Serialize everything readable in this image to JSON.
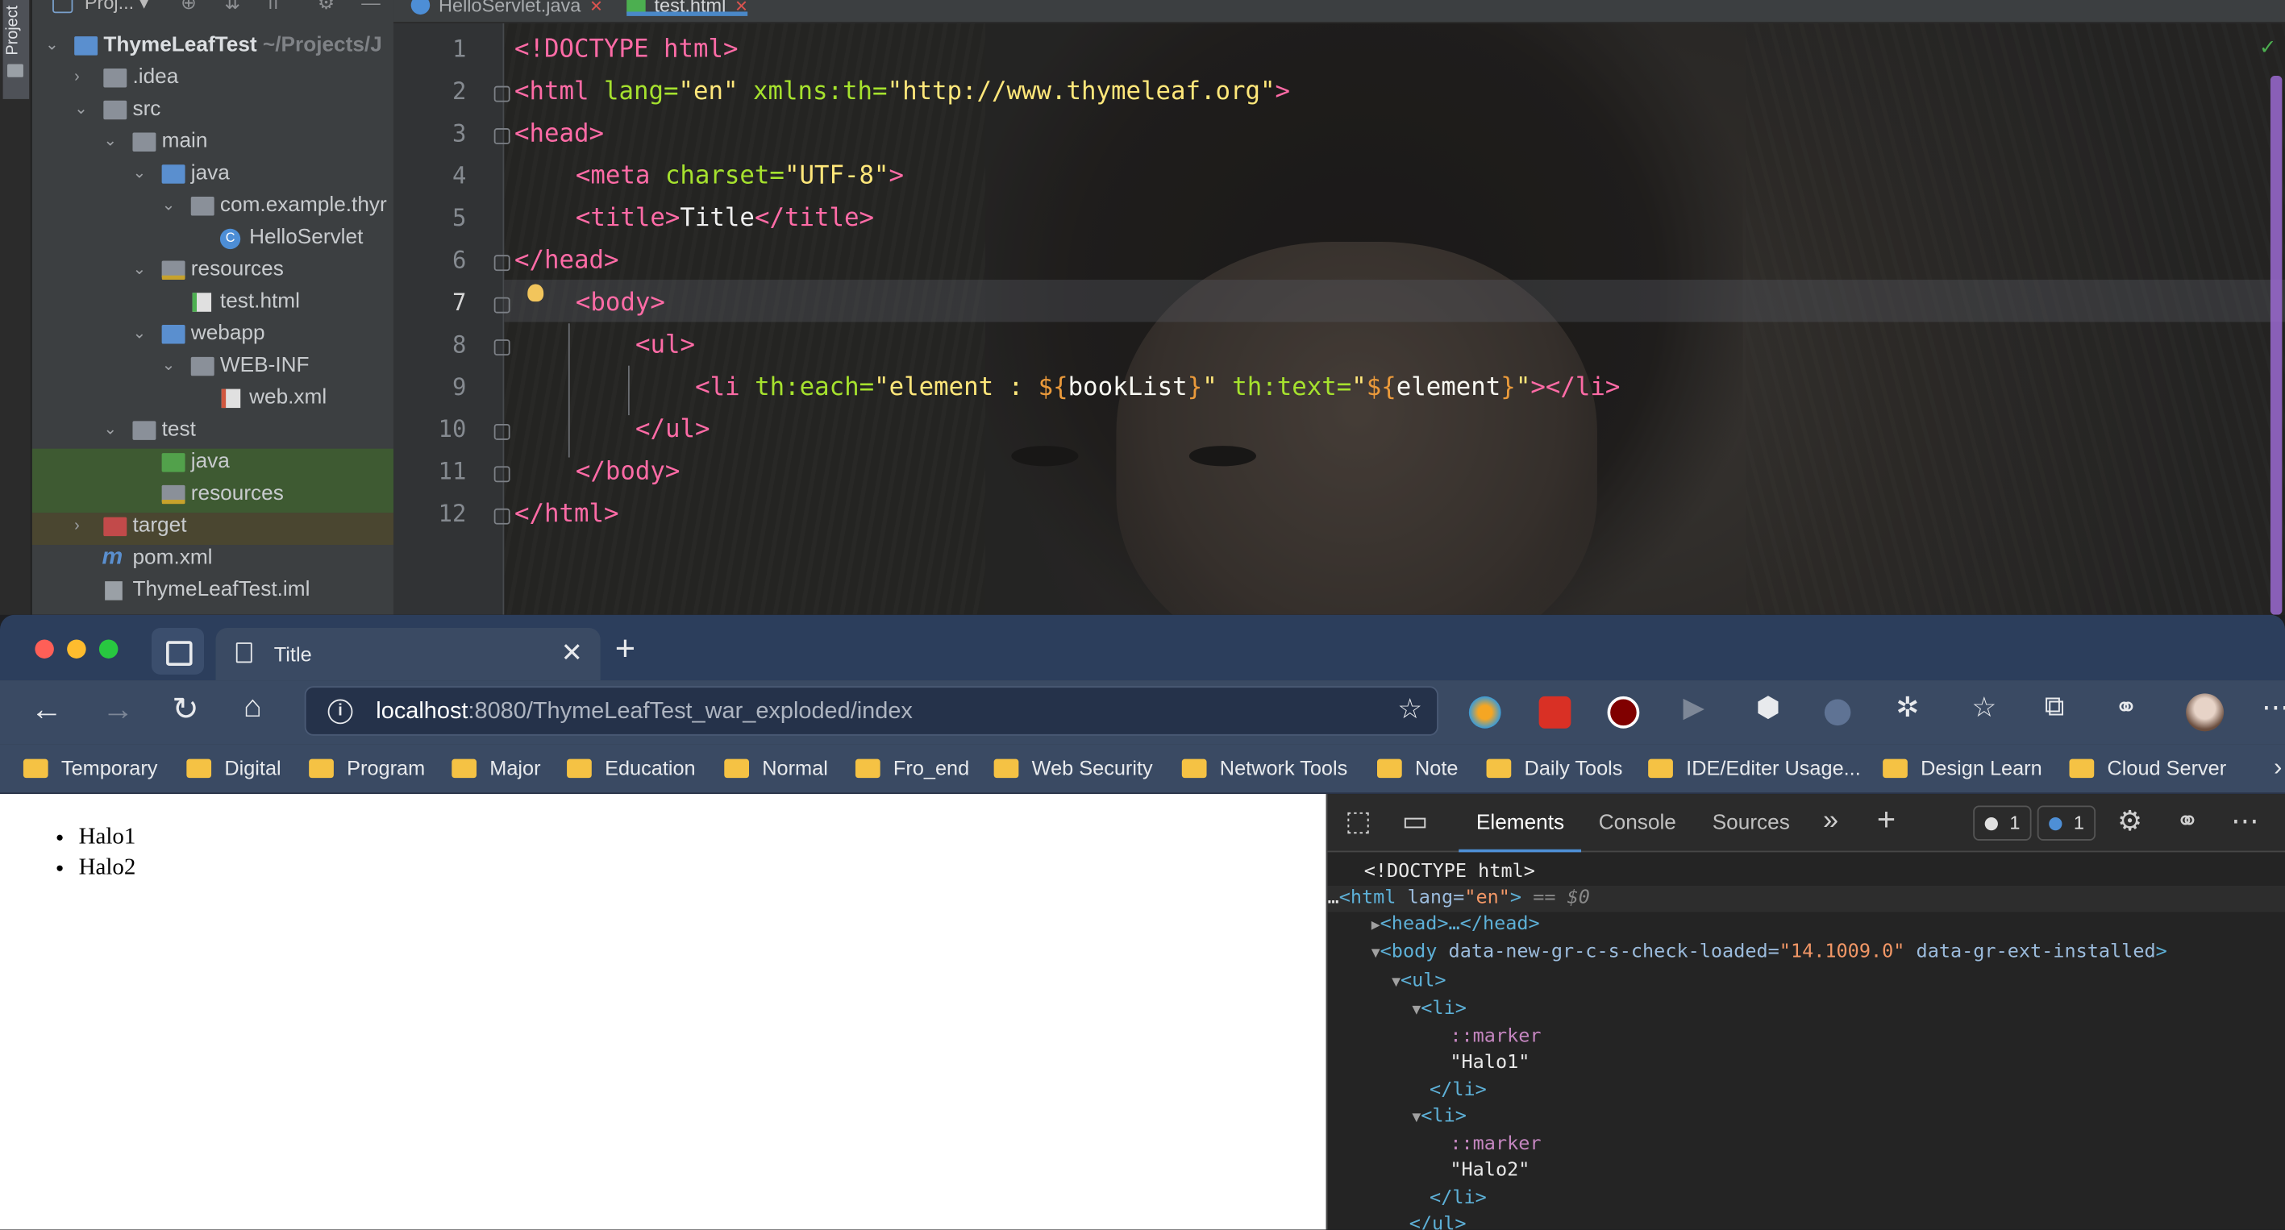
{
  "ide": {
    "project_label": "Proj...",
    "sidebar_tab_label": "Project",
    "tabs": [
      {
        "label": "HelloServlet.java"
      },
      {
        "label": "test.html"
      }
    ],
    "tree": [
      {
        "label": "ThymeLeafTest",
        "sub": "~/Projects/J"
      },
      {
        "label": ".idea"
      },
      {
        "label": "src"
      },
      {
        "label": "main"
      },
      {
        "label": "java"
      },
      {
        "label": "com.example.thyr"
      },
      {
        "label": "HelloServlet"
      },
      {
        "label": "resources"
      },
      {
        "label": "test.html"
      },
      {
        "label": "webapp"
      },
      {
        "label": "WEB-INF"
      },
      {
        "label": "web.xml"
      },
      {
        "label": "test"
      },
      {
        "label": "java"
      },
      {
        "label": "resources"
      },
      {
        "label": "target"
      },
      {
        "label": "pom.xml"
      },
      {
        "label": "ThymeLeafTest.iml"
      }
    ],
    "line_numbers": [
      "1",
      "2",
      "3",
      "4",
      "5",
      "6",
      "7",
      "8",
      "9",
      "10",
      "11",
      "12"
    ],
    "code": {
      "l1": [
        "<!DOCTYPE html>"
      ],
      "l2": [
        "<html",
        " lang=",
        "\"en\"",
        " xmlns:th=",
        "\"http://www.thymeleaf.org\"",
        ">"
      ],
      "l3": [
        "<head>"
      ],
      "l4": [
        "<meta",
        " charset=",
        "\"UTF-8\"",
        ">"
      ],
      "l5": [
        "<title>",
        "Title",
        "</title>"
      ],
      "l6": [
        "</head>"
      ],
      "l7": [
        "<body>"
      ],
      "l8": [
        "<ul>"
      ],
      "l9": [
        "<li",
        " th:each=",
        "\"element : ",
        "${",
        "bookList",
        "}",
        "\"",
        " th:text=",
        "\"",
        "${",
        "element",
        "}",
        "\"",
        "></li>"
      ],
      "l10": [
        "</ul>"
      ],
      "l11": [
        "</body>"
      ],
      "l12": [
        "</html>"
      ]
    }
  },
  "browser": {
    "tab_title": "Title",
    "url_host": "localhost",
    "url_rest": ":8080/ThymeLeafTest_war_exploded/index",
    "bookmarks": [
      "Temporary",
      "Digital",
      "Program",
      "Major",
      "Education",
      "Normal",
      "Fro_end",
      "Web Security",
      "Network Tools",
      "Note",
      "Daily Tools",
      "IDE/Editer Usage...",
      "Design Learn",
      "Cloud Server"
    ],
    "page_items": [
      "Halo1",
      "Halo2"
    ]
  },
  "devtools": {
    "tabs": [
      "Elements",
      "Console",
      "Sources"
    ],
    "issues_count": "1",
    "messages_count": "1",
    "dom": {
      "doctype": "<!DOCTYPE html>",
      "html_open": "<html",
      "lang_attr": " lang=",
      "lang_val": "\"en\"",
      "html_close_bracket": ">",
      "selected_marker": " == $0",
      "head": "<head>…</head>",
      "body_open": "<body",
      "body_attr1": " data-new-gr-c-s-check-loaded=",
      "body_val1": "\"14.1009.0\"",
      "body_attr2": " data-gr-ext-installed",
      "body_close_bracket": ">",
      "ul_open": "<ul>",
      "li_open": "<li>",
      "marker": "::marker",
      "text1": "\"Halo1\"",
      "li_close": "</li>",
      "text2": "\"Halo2\"",
      "ul_close": "</ul>"
    }
  },
  "colors": {
    "tag": "#ff6ba6",
    "attr": "#a6e22e",
    "string": "#ffe77a",
    "expr": "#eb9a3b",
    "devtools_accent": "#4e8fd6"
  }
}
